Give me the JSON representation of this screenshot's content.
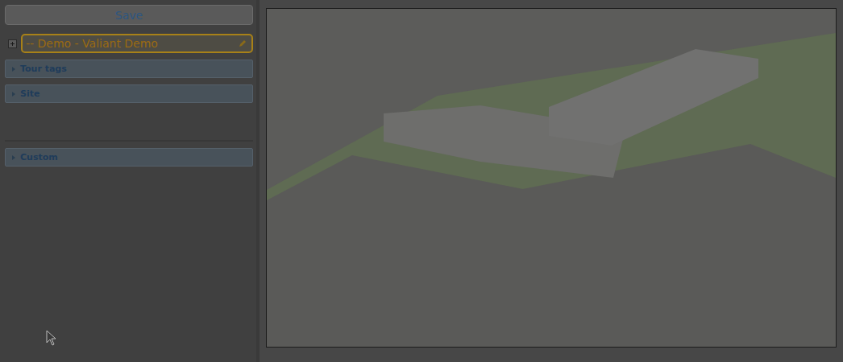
{
  "save_button": {
    "label": "Save"
  },
  "tree_item": {
    "label": "-- Demo - Valiant Demo",
    "expanded": false
  },
  "sections": [
    {
      "label": "Tour tags",
      "expanded": false,
      "kind": "plain"
    },
    {
      "label": "Site",
      "expanded": false,
      "kind": "panel"
    },
    {
      "label": "Custom",
      "expanded": false,
      "kind": "plain"
    }
  ]
}
